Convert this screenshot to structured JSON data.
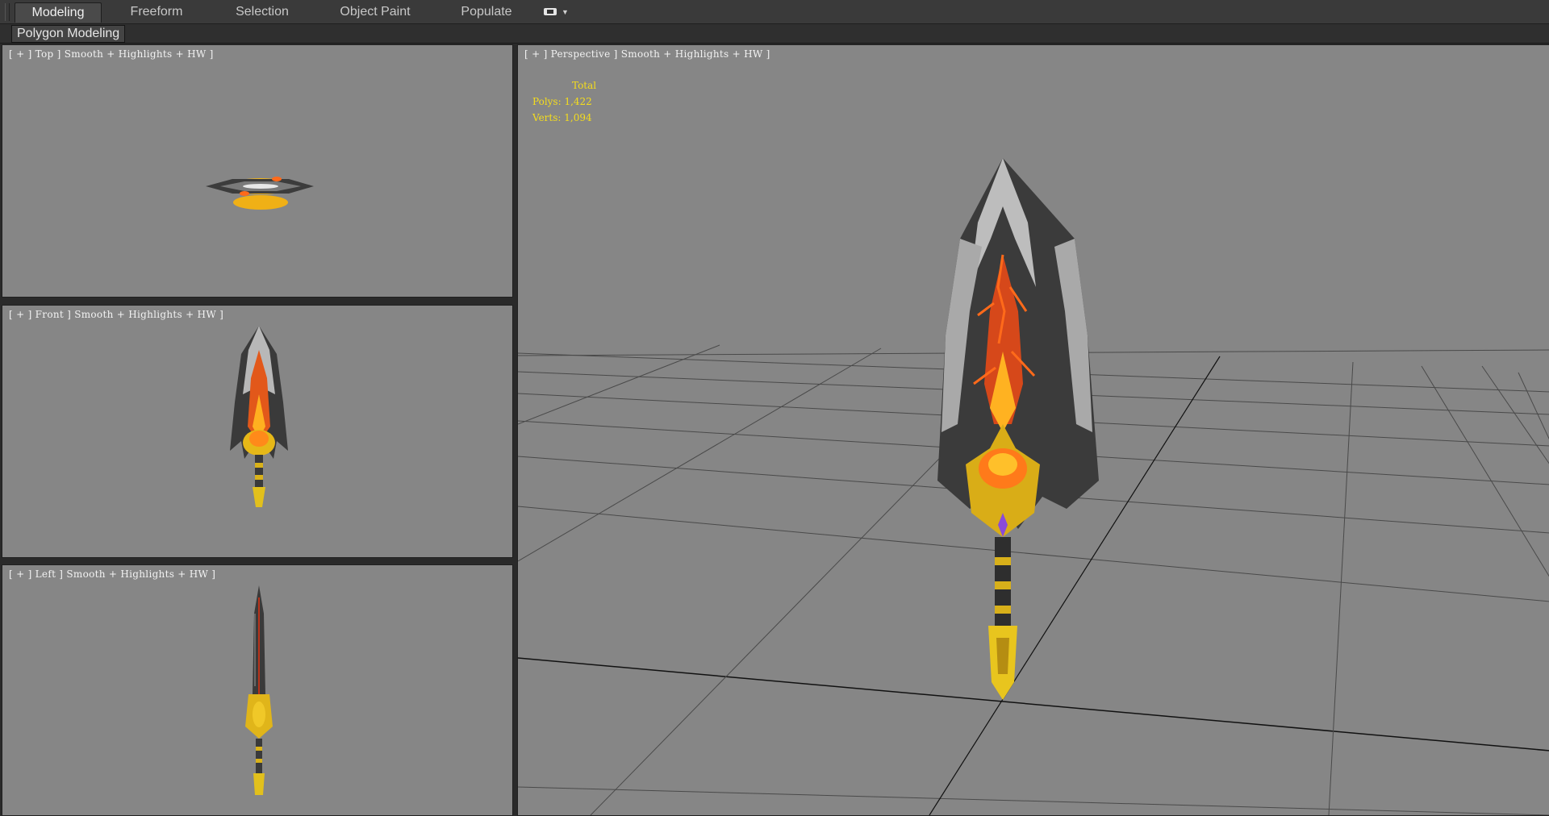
{
  "ribbon": {
    "tabs": [
      {
        "label": "Modeling",
        "active": true
      },
      {
        "label": "Freeform",
        "active": false
      },
      {
        "label": "Selection",
        "active": false
      },
      {
        "label": "Object Paint",
        "active": false
      },
      {
        "label": "Populate",
        "active": false
      }
    ],
    "dropdown_icon": "display-options-icon",
    "panel_label": "Polygon Modeling"
  },
  "viewports": {
    "top": {
      "label": "[ + ] Top ] Smooth + Highlights + HW ]"
    },
    "front": {
      "label": "[ + ] Front ] Smooth + Highlights + HW ]"
    },
    "left": {
      "label": "[ + ] Left ] Smooth + Highlights + HW ]"
    },
    "perspective": {
      "label": "[ + ] Perspective ] Smooth + Highlights + HW ]",
      "stats": {
        "header": "Total",
        "polys": "Polys: 1,422",
        "verts": "Verts: 1,094"
      }
    }
  },
  "colors": {
    "viewport_bg": "#868686",
    "stats_text": "#f5dd1c",
    "ui_dark": "#2b2b2b"
  }
}
